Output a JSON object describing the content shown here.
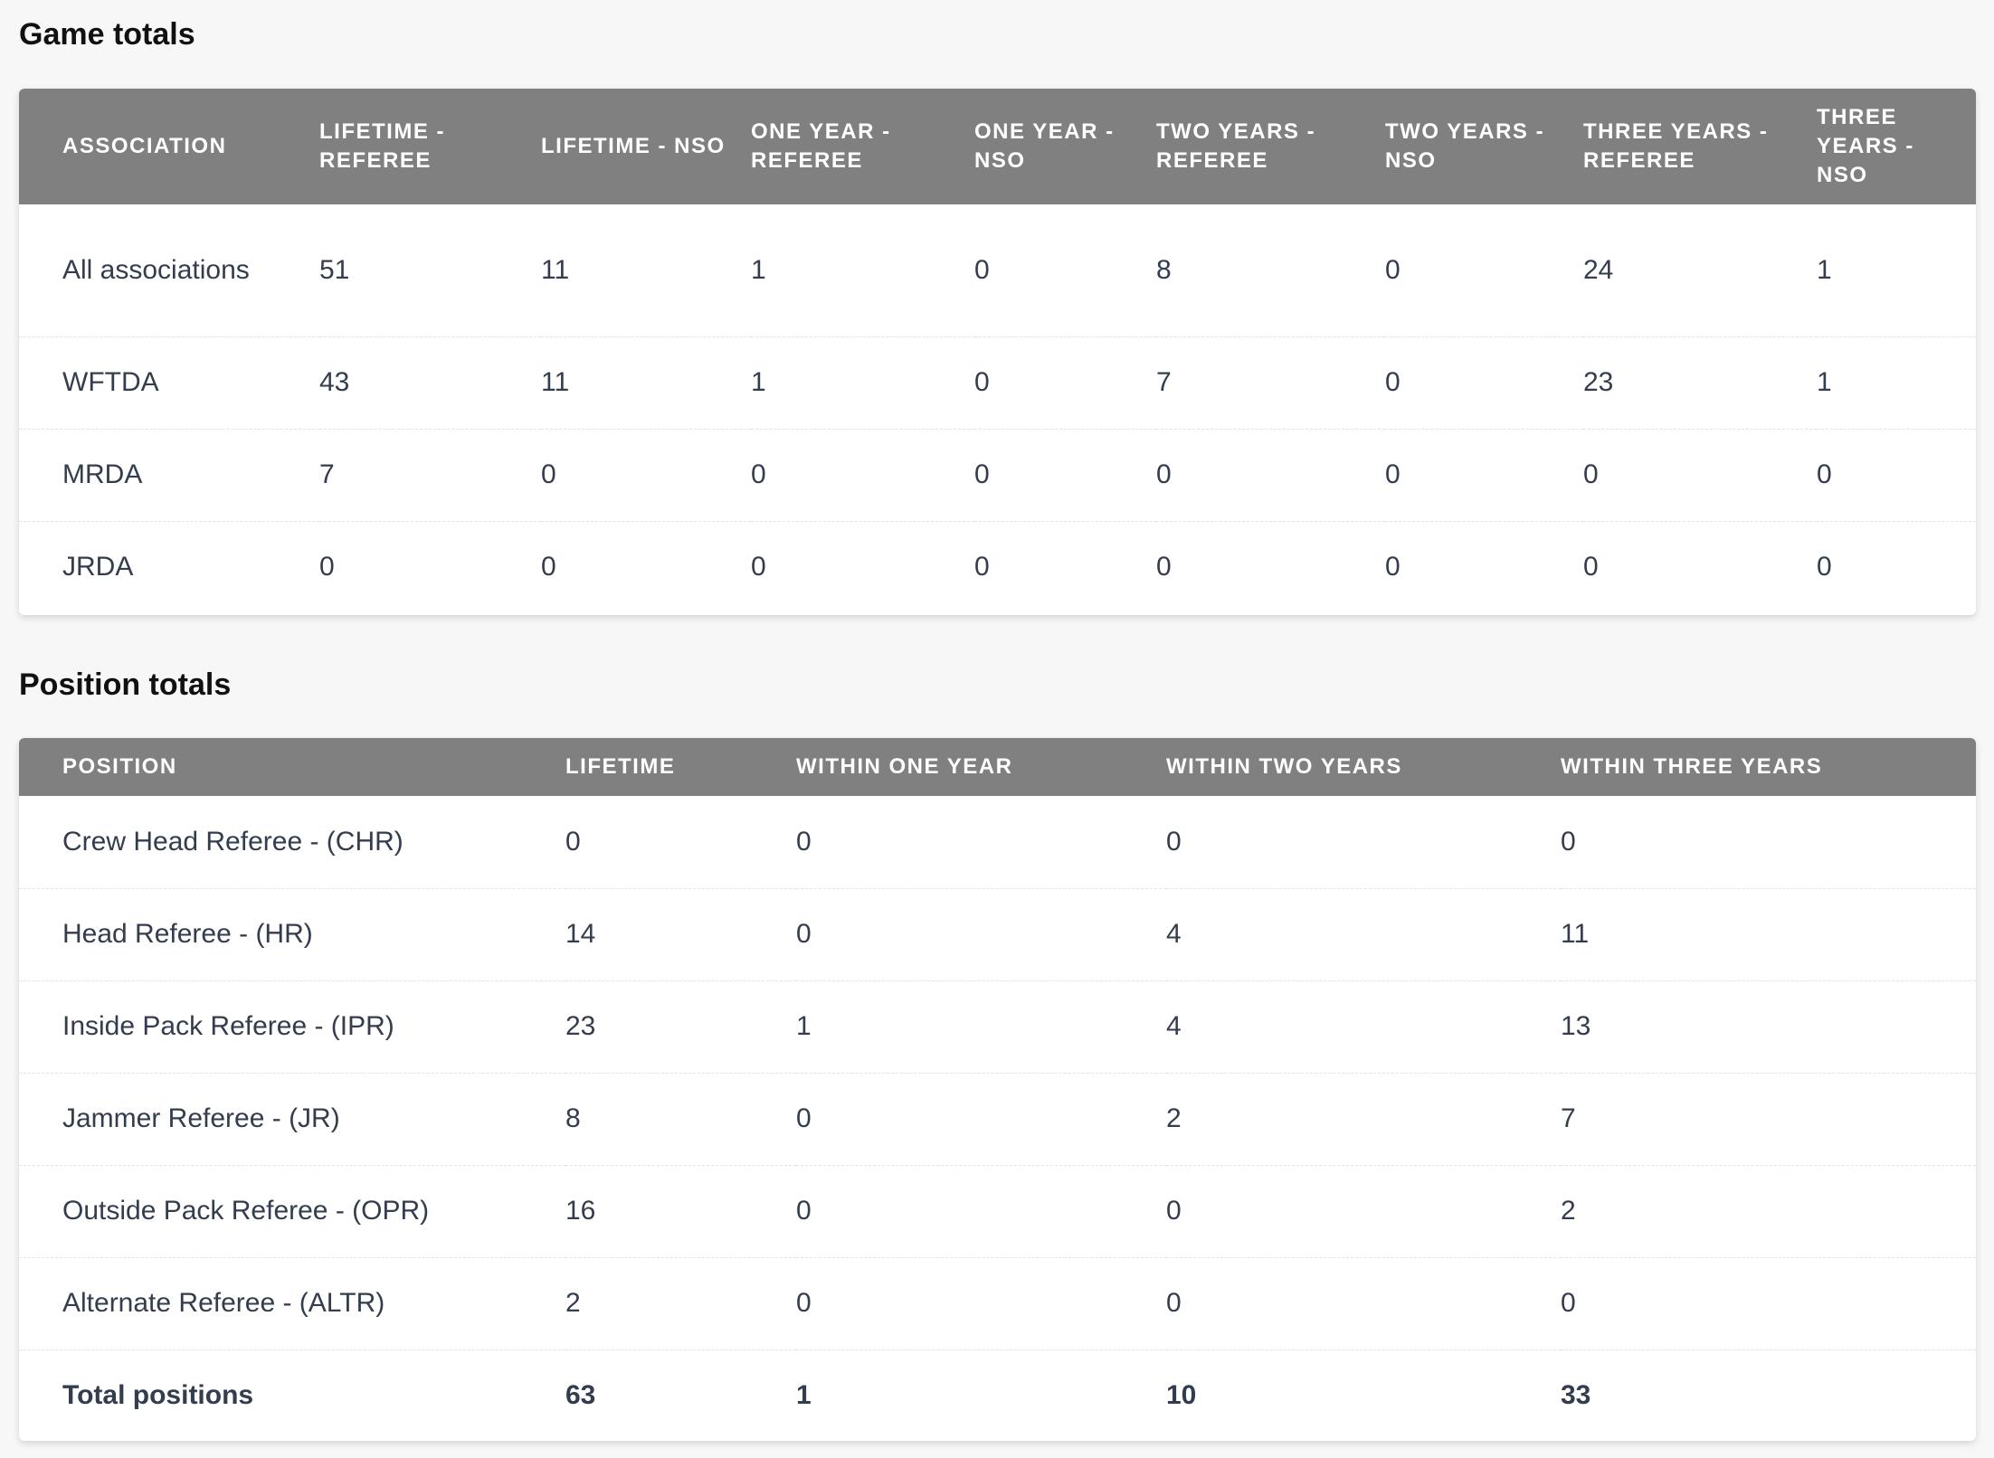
{
  "game_totals": {
    "title": "Game totals",
    "headers": [
      "Association",
      "Lifetime - Referee",
      "Lifetime - NSO",
      "One year - Referee",
      "One year - NSO",
      "Two years - Referee",
      "Two years - NSO",
      "Three years - Referee",
      "Three years - NSO"
    ],
    "rows": [
      [
        "All associations",
        "51",
        "11",
        "1",
        "0",
        "8",
        "0",
        "24",
        "1"
      ],
      [
        "WFTDA",
        "43",
        "11",
        "1",
        "0",
        "7",
        "0",
        "23",
        "1"
      ],
      [
        "MRDA",
        "7",
        "0",
        "0",
        "0",
        "0",
        "0",
        "0",
        "0"
      ],
      [
        "JRDA",
        "0",
        "0",
        "0",
        "0",
        "0",
        "0",
        "0",
        "0"
      ]
    ]
  },
  "position_totals": {
    "title": "Position totals",
    "headers": [
      "Position",
      "Lifetime",
      "Within one year",
      "Within two years",
      "Within three years"
    ],
    "rows": [
      [
        "Crew Head Referee - (CHR)",
        "0",
        "0",
        "0",
        "0"
      ],
      [
        "Head Referee - (HR)",
        "14",
        "0",
        "4",
        "11"
      ],
      [
        "Inside Pack Referee - (IPR)",
        "23",
        "1",
        "4",
        "13"
      ],
      [
        "Jammer Referee - (JR)",
        "8",
        "0",
        "2",
        "7"
      ],
      [
        "Outside Pack Referee - (OPR)",
        "16",
        "0",
        "0",
        "2"
      ],
      [
        "Alternate Referee - (ALTR)",
        "2",
        "0",
        "0",
        "0"
      ]
    ],
    "total_row": [
      "Total positions",
      "63",
      "1",
      "10",
      "33"
    ]
  }
}
